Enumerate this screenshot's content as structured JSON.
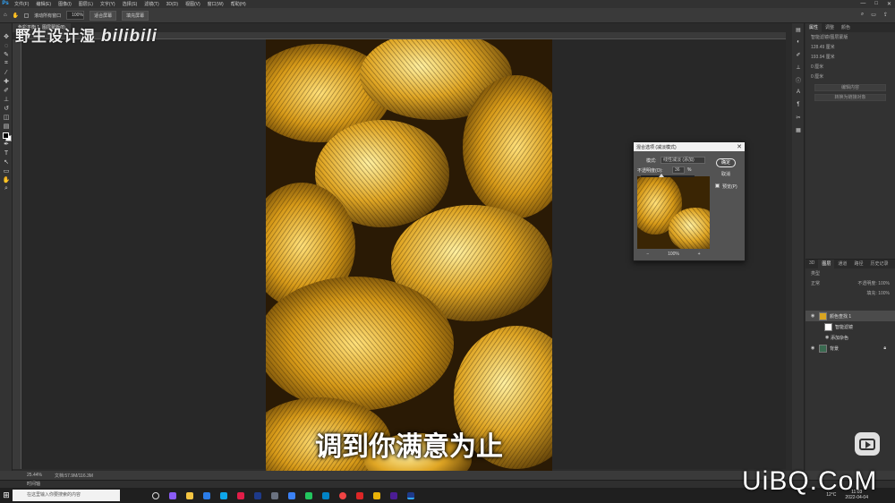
{
  "menu": [
    "文件(F)",
    "编辑(E)",
    "图像(I)",
    "图层(L)",
    "文字(Y)",
    "选择(S)",
    "滤镜(T)",
    "3D(D)",
    "视图(V)",
    "窗口(W)",
    "帮助(H)"
  ],
  "options": {
    "scroll_all": "滚动所有窗口",
    "zoom": "100%",
    "fit_screen": "适合屏幕",
    "fill_screen": "填充屏幕"
  },
  "tab": {
    "label": "色彩平衡 1, 图层蒙版/8)"
  },
  "watermark": {
    "text": "野生设计湿",
    "bili": "bilibili"
  },
  "subtitle": "调到你满意为止",
  "dialog": {
    "title": "混合选项 (减淡模式)",
    "mode_label": "模式:",
    "mode_value": "线性减淡 (添加)",
    "opacity_label": "不透明度(O):",
    "opacity_value": "36",
    "opacity_unit": "%",
    "ok": "确定",
    "cancel": "取消",
    "preview": "预览(P)",
    "zoom_out": "−",
    "zoom_value": "100%",
    "zoom_in": "+"
  },
  "properties": {
    "tabs": [
      "属性",
      "调整",
      "颜色"
    ],
    "row1": "智能滤镜/图层蒙版",
    "row2": "128.49 厘米",
    "row3": "193.94 厘米",
    "row4": "0 厘米",
    "row5": "0 厘米",
    "btn1": "编辑内容",
    "btn2": "转换为链接对象"
  },
  "layers": {
    "tabs": [
      "3D",
      "图层",
      "通道",
      "路径",
      "历史记录"
    ],
    "kind": "类型",
    "blend": "正常",
    "opacity": "不透明度: 100%",
    "fill": "填充: 100%",
    "items": [
      {
        "name": "颜色查找 1",
        "selected": true
      },
      {
        "name": "智能滤镜",
        "selected": false
      },
      {
        "name": "添加杂色",
        "selected": false
      },
      {
        "name": "背景",
        "selected": false
      }
    ]
  },
  "status": {
    "zoom": "25.44%",
    "doc": "文档:57.9M/116.3M"
  },
  "timeline": "时间轴",
  "taskbar": {
    "search_placeholder": "在这里输入你要搜索的内容",
    "temp": "12°C",
    "time": "11:03",
    "date": "2022-04-04"
  },
  "site_watermark": "UiBQ.CoM",
  "colors": {
    "gold": "#d9a520",
    "dark_gold": "#3a2504",
    "accent": "#31a8ff"
  }
}
